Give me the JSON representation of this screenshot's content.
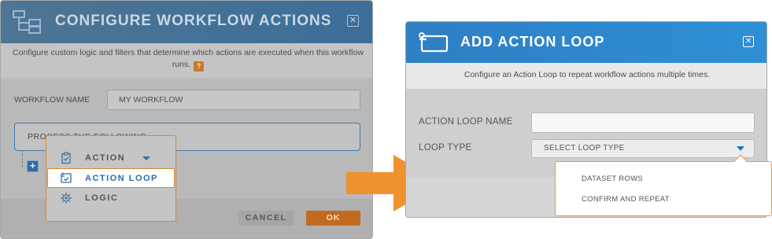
{
  "colors": {
    "left_header": "#3b6e99",
    "right_header": "#2e8fd4",
    "accent_orange": "#f0922f",
    "ok_button": "#c46a1e",
    "link_blue": "#2f6aa3"
  },
  "configure_dialog": {
    "title": "CONFIGURE WORKFLOW ACTIONS",
    "title_icon": "workflow-icon",
    "close_glyph": "✕",
    "description": "Configure custom logic and filters that determine which actions are executed when this workflow runs.",
    "help_glyph": "?",
    "workflow_name_label": "WORKFLOW NAME",
    "workflow_name_value": "MY WORKFLOW",
    "process_text": "PROCESS THE FOLLOWING",
    "add_glyph": "+",
    "cancel_label": "CANCEL",
    "ok_label": "OK"
  },
  "add_menu": {
    "items": [
      {
        "label": "ACTION",
        "icon": "clipboard-check-icon",
        "has_caret": true
      },
      {
        "label": "ACTION LOOP",
        "icon": "loop-check-icon",
        "selected": true
      },
      {
        "label": "LOGIC",
        "icon": "logic-gear-icon"
      }
    ]
  },
  "arrow": {
    "icon": "right-arrow-icon",
    "color": "#f0922f"
  },
  "loop_dialog": {
    "title": "ADD ACTION LOOP",
    "title_icon": "action-loop-icon",
    "close_glyph": "✕",
    "description": "Configure an Action Loop to repeat workflow actions multiple times.",
    "name_label": "ACTION LOOP NAME",
    "name_value": "",
    "type_label": "LOOP TYPE",
    "type_placeholder": "SELECT LOOP TYPE"
  },
  "loop_type_options": [
    "DATASET ROWS",
    "CONFIRM AND REPEAT"
  ]
}
